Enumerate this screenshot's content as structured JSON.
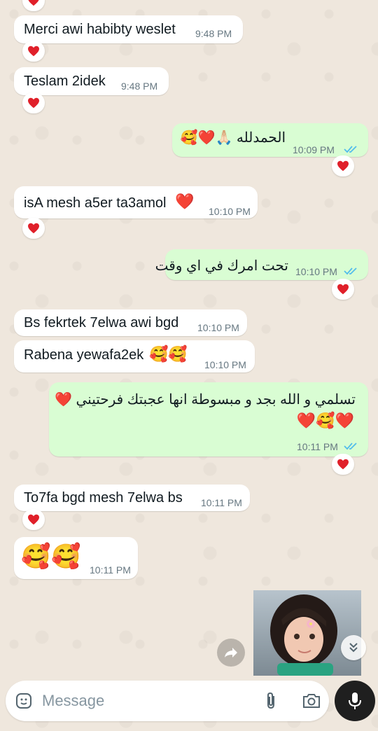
{
  "messages": [
    {
      "text": "Merci awi habibty weslet",
      "time": "9:48 PM",
      "reaction": "heart"
    },
    {
      "text": "Teslam 2idek",
      "time": "9:48 PM",
      "reaction": "heart"
    },
    {
      "text": "الحمدلله 🙏🏻❤️🥰",
      "time": "10:09 PM",
      "reaction": "heart"
    },
    {
      "text": "isA mesh a5er ta3amol",
      "emoji": "❤️",
      "time": "10:10 PM",
      "reaction": "heart"
    },
    {
      "text": "تحت امرك في اي وقت",
      "time": "10:10 PM",
      "reaction": "heart"
    },
    {
      "text": "Bs fekrtek 7elwa awi bgd",
      "time": "10:10 PM"
    },
    {
      "text": "Rabena yewafa2ek",
      "emoji": "🥰🥰",
      "time": "10:10 PM"
    },
    {
      "text": "تسلمي و الله بجد و مبسوطة انها عجبتك فرحتيني ❤️",
      "line2": "❤️🥰❤️",
      "time": "10:11 PM",
      "reaction": "heart"
    },
    {
      "text": "To7fa bgd mesh 7elwa bs",
      "time": "10:11 PM",
      "reaction": "heart"
    },
    {
      "emoji": "🥰🥰",
      "time": "10:11 PM"
    }
  ],
  "input": {
    "placeholder": "Message"
  },
  "icons": {
    "sticker": "sticker-icon",
    "attach": "paperclip-icon",
    "camera": "camera-icon",
    "mic": "mic-icon",
    "scroll_down": "double-chevron-down-icon",
    "forward": "forward-icon"
  },
  "colors": {
    "incoming": "#ffffff",
    "outgoing": "#d9fdd3",
    "read_ticks": "#53bdeb",
    "reaction_heart": "#e0202a"
  }
}
